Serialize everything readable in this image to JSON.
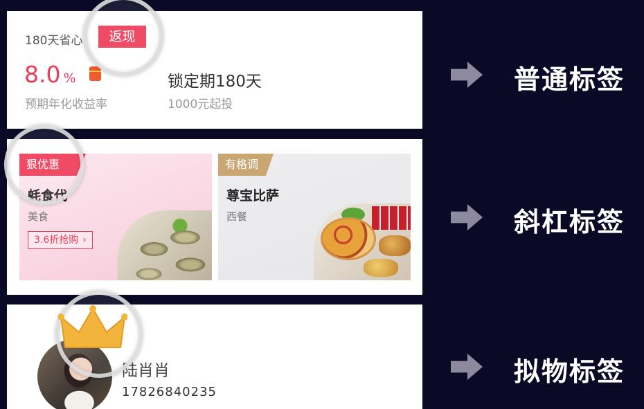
{
  "card1": {
    "title": "180天省心",
    "tag": "返现",
    "rate": "8.0",
    "rate_unit": "%",
    "rate_label": "预期年化收益率",
    "lock_period": "锁定期180天",
    "min_invest": "1000元起投",
    "accent_color": "#ee3c58"
  },
  "card2": {
    "item1": {
      "tag": "狠优惠",
      "name": "蚝食代",
      "category": "美食",
      "button": "3.6折抢购",
      "button_icon": "chevron-right-icon",
      "tag_color": "#ee3c58"
    },
    "item2": {
      "tag": "有格调",
      "name": "尊宝比萨",
      "category": "西餐",
      "tag_color": "#c9a672"
    }
  },
  "card3": {
    "name": "陆肖肖",
    "phone": "17826840235",
    "badge_icon": "crown-icon",
    "crown_color": "#f2b43a"
  },
  "side_labels": [
    {
      "text": "普通标签",
      "icon": "arrow-right-icon"
    },
    {
      "text": "斜杠标签",
      "icon": "arrow-right-icon"
    },
    {
      "text": "拟物标签",
      "icon": "arrow-right-icon"
    }
  ],
  "background_color": "#0b0a26"
}
